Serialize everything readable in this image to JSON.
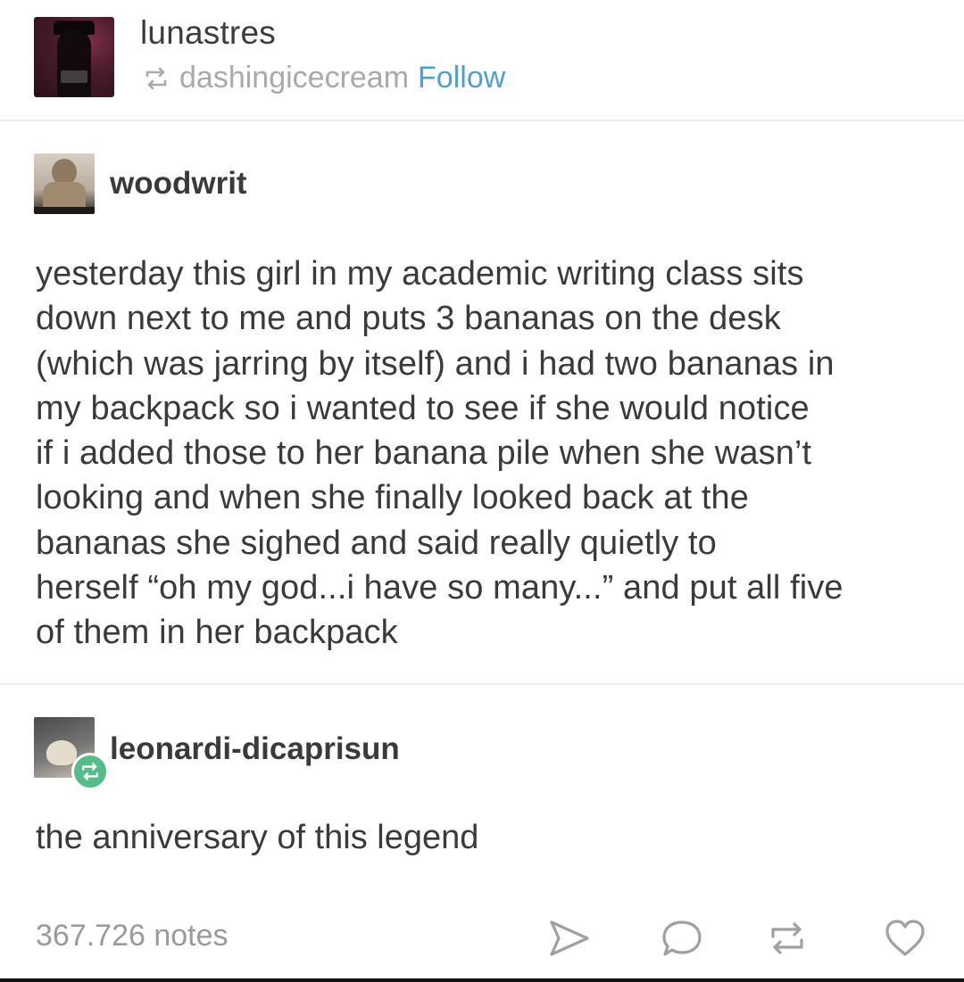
{
  "header": {
    "blog_name": "lunastres",
    "reblogged_from": "dashingicecream",
    "follow_label": "Follow"
  },
  "trail": [
    {
      "username": "woodwrit",
      "body": "yesterday this girl in my academic writing class sits\ndown next to me and puts 3 bananas on the desk\n(which was jarring by itself) and i had two bananas in\nmy backpack so i wanted to see if she would notice\nif i added those to her banana pile when she wasn’t\nlooking and when she finally looked back at the\nbananas she sighed and said really quietly to\nherself “oh my god...i have so many...” and put all five\nof them in her backpack"
    },
    {
      "username": "leonardi-dicaprisun",
      "body": "the anniversary of this legend"
    }
  ],
  "footer": {
    "notes": "367.726 notes",
    "actions": {
      "share_icon": "share-icon",
      "reply_icon": "reply-icon",
      "reblog_icon": "reblog-icon",
      "like_icon": "heart-icon"
    }
  },
  "colors": {
    "text": "#3a3a3a",
    "muted": "#a9a9a9",
    "link": "#529ecc",
    "reblog_badge": "#56bc8a",
    "divider": "#ececec"
  }
}
